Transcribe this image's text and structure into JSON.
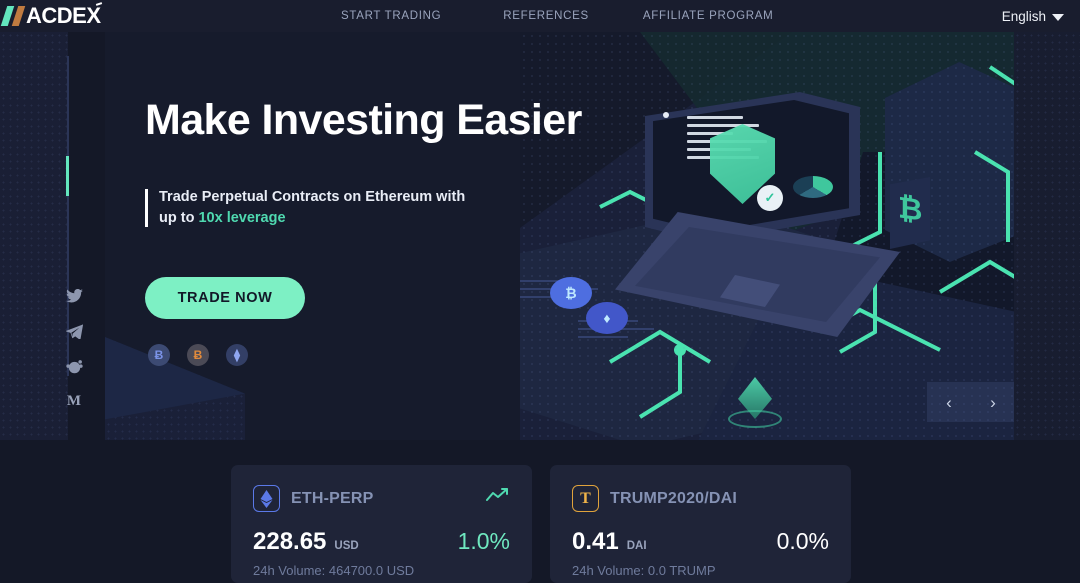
{
  "header": {
    "logo": {
      "text": "ACDEX",
      "slash_colors": [
        "#63e6be",
        "#c07b40"
      ]
    },
    "nav": [
      {
        "label": "START TRADING",
        "name": "nav-start-trading"
      },
      {
        "label": "REFERENCES",
        "name": "nav-references"
      },
      {
        "label": "AFFILIATE PROGRAM",
        "name": "nav-affiliate-program"
      }
    ],
    "language": {
      "label": "English",
      "caret": "chevron-down-icon"
    }
  },
  "sidebar": {
    "socials": [
      {
        "name": "twitter-icon",
        "label": "Twitter"
      },
      {
        "name": "telegram-icon",
        "label": "Telegram"
      },
      {
        "name": "reddit-icon",
        "label": "Reddit"
      },
      {
        "name": "medium-icon",
        "label": "M"
      }
    ]
  },
  "hero": {
    "title": "Make Investing Easier",
    "subtitle_line1": "Trade Perpetual Contracts on Ethereum with",
    "subtitle_line2_prefix": "up to ",
    "subtitle_highlight": "10x leverage",
    "cta_label": "TRADE NOW",
    "accent_color": "#7df0c4",
    "highlight_color": "#4fd9b0",
    "coins": [
      {
        "name": "coin-bitcoin",
        "symbol": "Ƀ"
      },
      {
        "name": "coin-bsv",
        "symbol": "Ƀ"
      },
      {
        "name": "coin-ethereum",
        "symbol": "⧫"
      }
    ],
    "carousel": {
      "prev": "‹",
      "next": "›"
    }
  },
  "tickers": [
    {
      "pair": "ETH-PERP",
      "badge_icon": "ethereum-icon",
      "badge_text": "◆",
      "price": "228.65",
      "unit": "USD",
      "change": "1.0%",
      "change_direction": "up",
      "volume": "24h Volume: 464700.0 USD",
      "has_trend_icon": true
    },
    {
      "pair": "TRUMP2020/DAI",
      "badge_icon": "trump-token-icon",
      "badge_text": "T",
      "price": "0.41",
      "unit": "DAI",
      "change": "0.0%",
      "change_direction": "flat",
      "volume": "24h Volume: 0.0 TRUMP",
      "has_trend_icon": false
    }
  ]
}
